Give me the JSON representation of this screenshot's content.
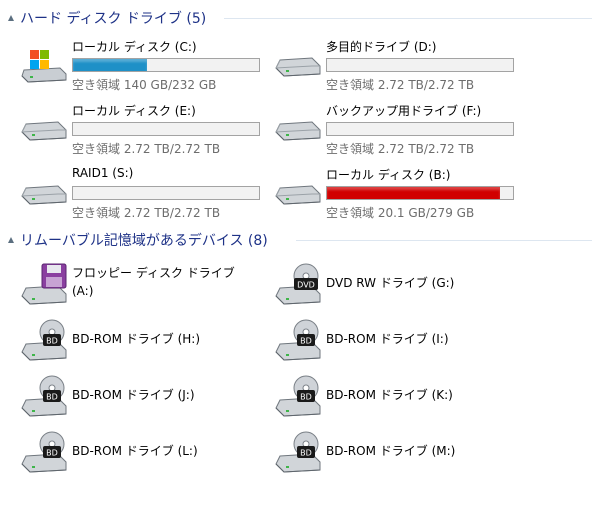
{
  "hard_disks": {
    "title": "ハード ディスク ドライブ (5)",
    "drives": [
      {
        "name": "ローカル ディスク (C:)",
        "free_text": "空き領域 140 GB/232 GB",
        "used_fraction": 0.4,
        "bar_color": "#1e90c7",
        "icon": "windows-drive-icon"
      },
      {
        "name": "多目的ドライブ (D:)",
        "free_text": "空き領域 2.72 TB/2.72 TB",
        "used_fraction": 0.0,
        "bar_color": "#1e90c7",
        "icon": "hard-drive-icon"
      },
      {
        "name": "ローカル ディスク (E:)",
        "free_text": "空き領域 2.72 TB/2.72 TB",
        "used_fraction": 0.0,
        "bar_color": "#1e90c7",
        "icon": "hard-drive-icon"
      },
      {
        "name": "バックアップ用ドライブ (F:)",
        "free_text": "空き領域 2.72 TB/2.72 TB",
        "used_fraction": 0.0,
        "bar_color": "#1e90c7",
        "icon": "hard-drive-icon"
      },
      {
        "name": "RAID1 (S:)",
        "free_text": "空き領域 2.72 TB/2.72 TB",
        "used_fraction": 0.0,
        "bar_color": "#1e90c7",
        "icon": "hard-drive-icon"
      },
      {
        "name": "ローカル ディスク (B:)",
        "free_text": "空き領域 20.1 GB/279 GB",
        "used_fraction": 0.93,
        "bar_color": "#d10000",
        "icon": "hard-drive-icon"
      }
    ]
  },
  "removable": {
    "title": "リムーバブル記憶域があるデバイス (8)",
    "devices": [
      {
        "name": "フロッピー ディスク ドライブ (A:)",
        "icon": "floppy-drive-icon"
      },
      {
        "name": "DVD RW ドライブ (G:)",
        "icon": "dvd-drive-icon",
        "disc_label": "DVD"
      },
      {
        "name": "BD-ROM ドライブ (H:)",
        "icon": "bd-drive-icon",
        "disc_label": "BD"
      },
      {
        "name": "BD-ROM ドライブ (I:)",
        "icon": "bd-drive-icon",
        "disc_label": "BD"
      },
      {
        "name": "BD-ROM ドライブ (J:)",
        "icon": "bd-drive-icon",
        "disc_label": "BD"
      },
      {
        "name": "BD-ROM ドライブ (K:)",
        "icon": "bd-drive-icon",
        "disc_label": "BD"
      },
      {
        "name": "BD-ROM ドライブ (L:)",
        "icon": "bd-drive-icon",
        "disc_label": "BD"
      },
      {
        "name": "BD-ROM ドライブ (M:)",
        "icon": "bd-drive-icon",
        "disc_label": "BD"
      }
    ]
  }
}
